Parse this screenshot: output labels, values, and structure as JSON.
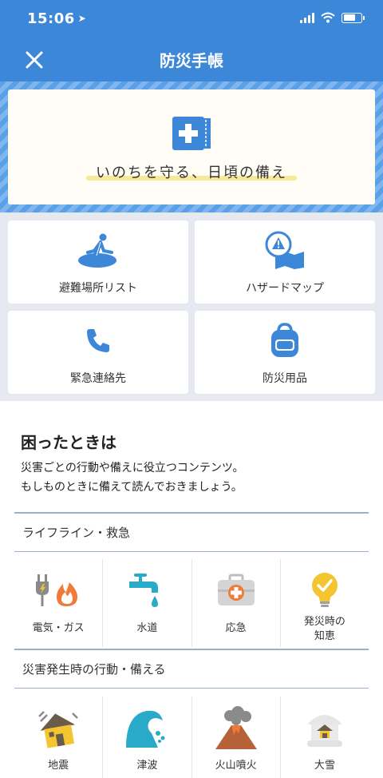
{
  "status": {
    "time": "15:06"
  },
  "header": {
    "title": "防災手帳"
  },
  "hero": {
    "tagline": "いのちを守る、日頃の備え"
  },
  "quick_menu": [
    {
      "label": "避難場所リスト",
      "icon": "evacuation-icon"
    },
    {
      "label": "ハザードマップ",
      "icon": "hazard-map-icon"
    },
    {
      "label": "緊急連絡先",
      "icon": "phone-icon"
    },
    {
      "label": "防災用品",
      "icon": "backpack-icon"
    }
  ],
  "trouble": {
    "title": "困ったときは",
    "desc_line1": "災害ごとの行動や備えに役立つコンテンツ。",
    "desc_line2": "もしものときに備えて読んでおきましょう。"
  },
  "categories": [
    {
      "name": "ライフライン・救急",
      "items": [
        {
          "label": "電気・ガス",
          "icon": "plug-flame-icon"
        },
        {
          "label": "水道",
          "icon": "faucet-icon"
        },
        {
          "label": "応急",
          "icon": "first-aid-kit-icon"
        },
        {
          "label": "発災時の\n知恵",
          "label_line1": "発災時の",
          "label_line2": "知恵",
          "icon": "lightbulb-icon"
        }
      ]
    },
    {
      "name": "災害発生時の行動・備える",
      "items": [
        {
          "label": "地震",
          "icon": "earthquake-house-icon"
        },
        {
          "label": "津波",
          "icon": "tsunami-wave-icon"
        },
        {
          "label": "火山噴火",
          "icon": "volcano-icon"
        },
        {
          "label": "大雪",
          "icon": "snow-house-icon"
        }
      ]
    }
  ],
  "colors": {
    "header": "#3d87d9",
    "accent": "#3d87d9",
    "grid_bg": "#e6e9f0"
  }
}
